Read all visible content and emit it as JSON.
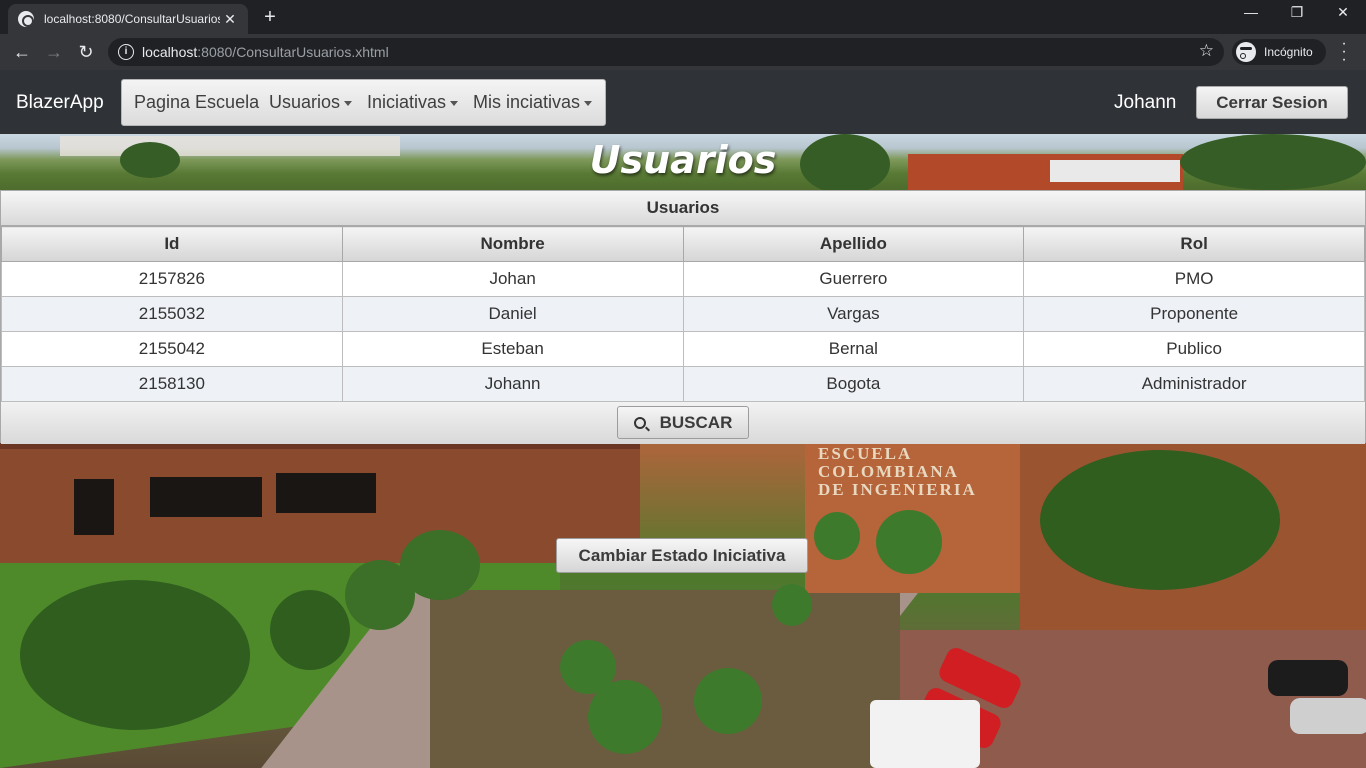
{
  "browser": {
    "tab_title": "localhost:8080/ConsultarUsuarios",
    "url_host": "localhost",
    "url_rest": ":8080/ConsultarUsuarios.xhtml",
    "incognito_label": "Incógnito",
    "icons": [
      "globe-icon",
      "close-icon",
      "plus-icon",
      "minimize-icon",
      "restore-icon",
      "back-icon",
      "forward-icon",
      "reload-icon",
      "info-icon",
      "star-icon",
      "incognito-icon",
      "menu-icon"
    ]
  },
  "navbar": {
    "brand": "BlazerApp",
    "menu": {
      "items": [
        {
          "label": "Pagina Escuela"
        },
        {
          "label": "Usuarios"
        },
        {
          "label": "Iniciativas"
        },
        {
          "label": "Mis inciativas"
        }
      ]
    },
    "username": "Johann",
    "logout_label": "Cerrar Sesion"
  },
  "hero": {
    "title": "Usuarios"
  },
  "panel": {
    "caption": "Usuarios",
    "columns": [
      "Id",
      "Nombre",
      "Apellido",
      "Rol"
    ],
    "rows": [
      [
        "2157826",
        "Johan",
        "Guerrero",
        "PMO"
      ],
      [
        "2155032",
        "Daniel",
        "Vargas",
        "Proponente"
      ],
      [
        "2155042",
        "Esteban",
        "Bernal",
        "Publico"
      ],
      [
        "2158130",
        "Johann",
        "Bogota",
        "Administrador"
      ]
    ],
    "search_label": "BUSCAR"
  },
  "actions": {
    "change_state_label": "Cambiar Estado Iniciativa"
  },
  "background": {
    "sign_text": [
      "ESCUELA",
      "COLOMBIANA",
      "DE INGENIERIA"
    ]
  }
}
